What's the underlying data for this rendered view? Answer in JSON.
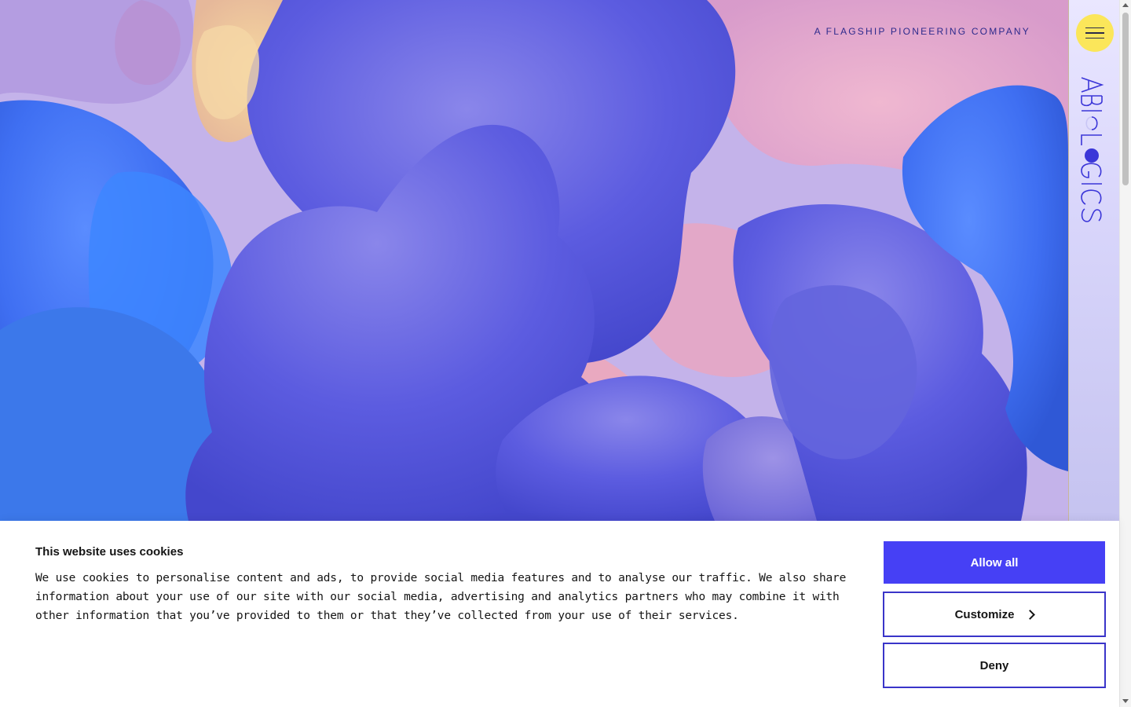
{
  "header": {
    "tagline": "A FLAGSHIP PIONEERING COMPANY"
  },
  "sidebar": {
    "menu_icon": "hamburger-icon",
    "logo_text": "ABIOLOGICS"
  },
  "cookie_banner": {
    "title": "This website uses cookies",
    "body": "We use cookies to personalise content and ads, to provide social media features and to analyse our traffic. We also share information about your use of our site with our social media, advertising and analytics partners who may combine it with other information that you’ve provided to them or that they’ve collected from your use of their services.",
    "allow_all_label": "Allow all",
    "customize_label": "Customize",
    "customize_icon": "chevron-right-icon",
    "deny_label": "Deny"
  },
  "colors": {
    "accent": "#4640f5",
    "menu_button": "#fbe65a",
    "tagline": "#2d2a8c"
  }
}
